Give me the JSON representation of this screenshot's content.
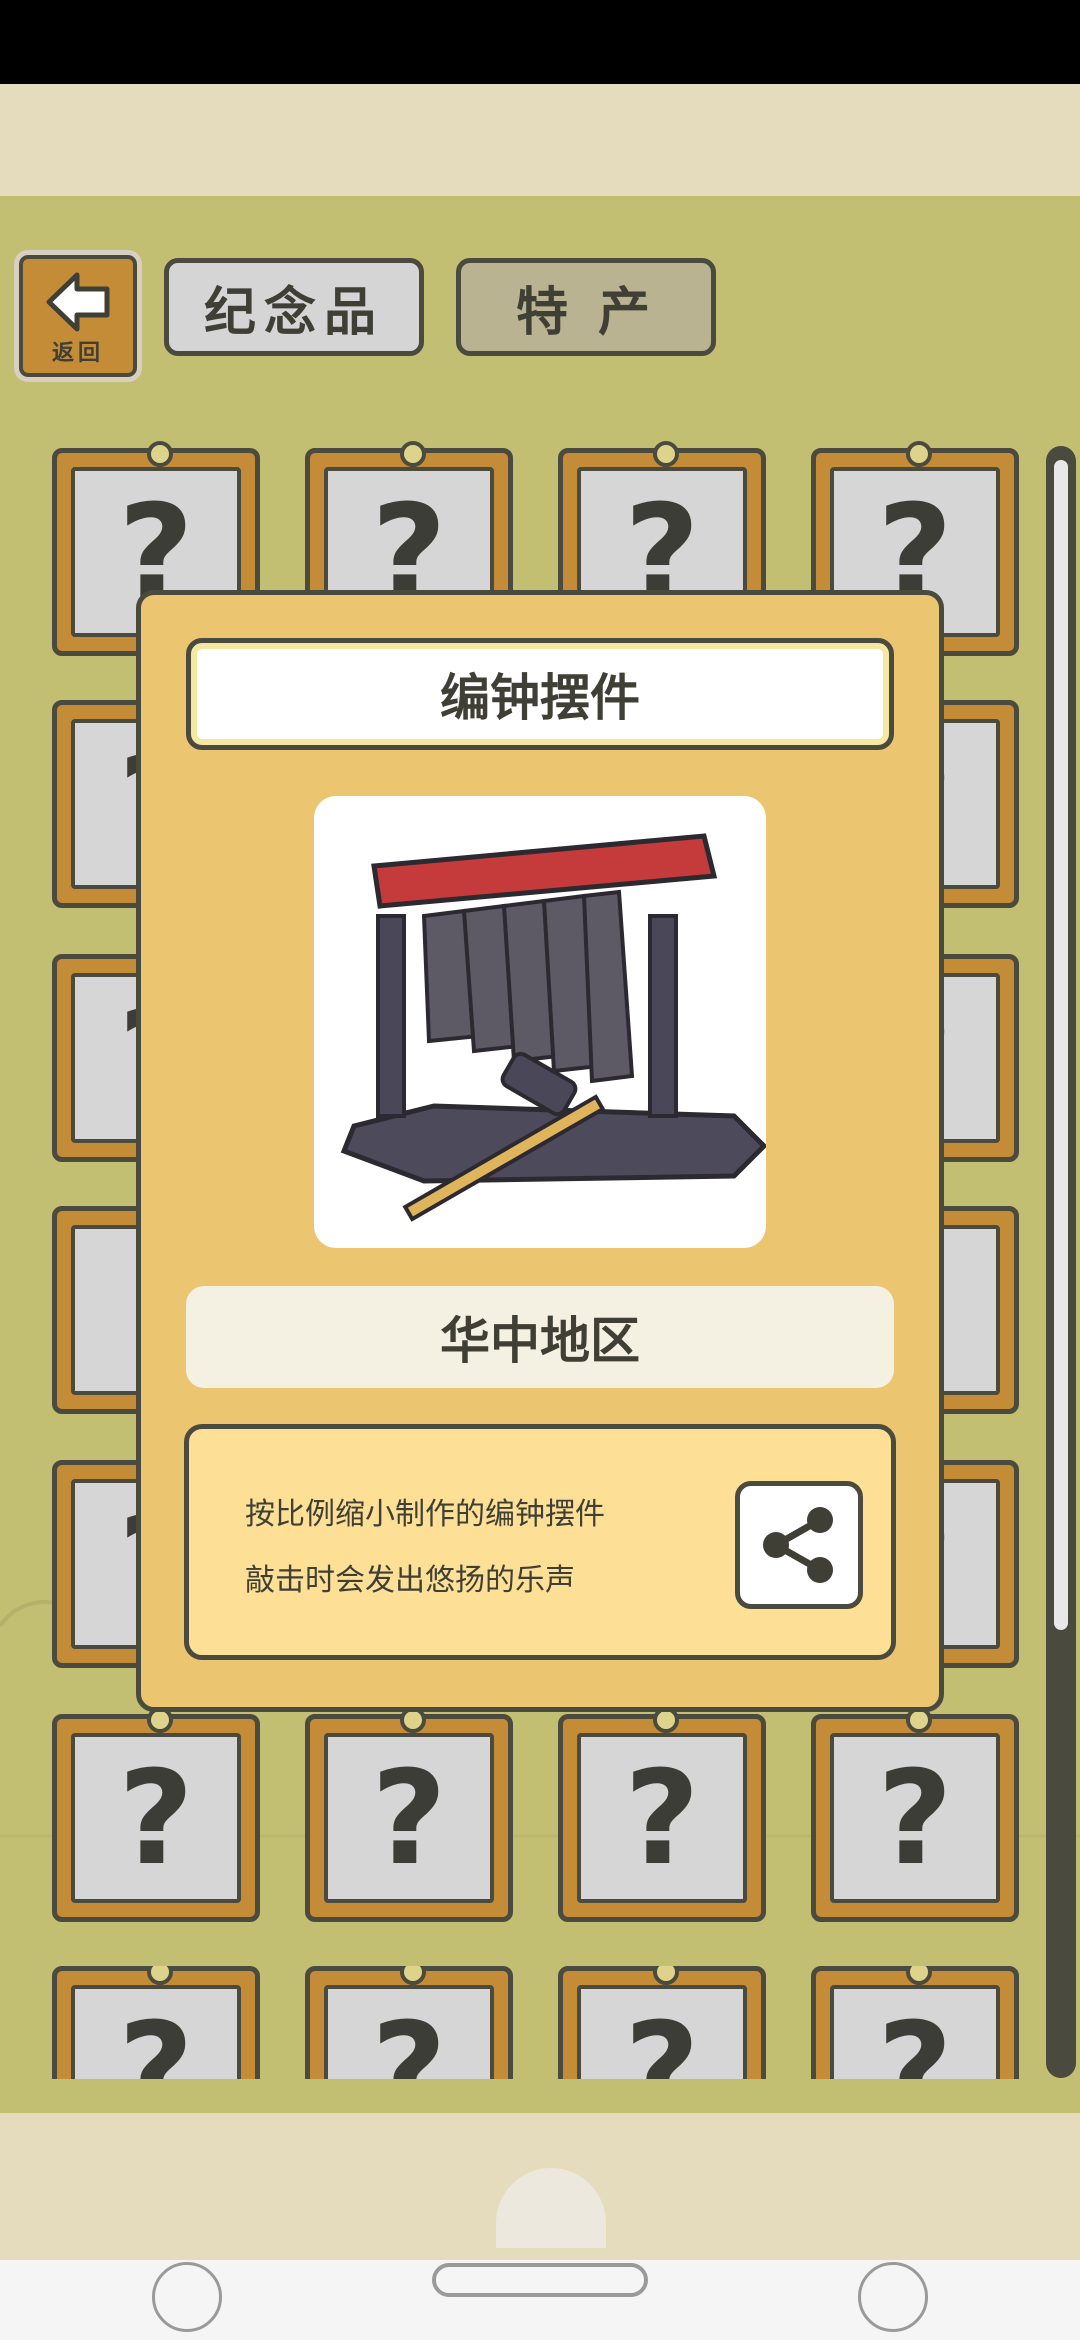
{
  "header": {
    "back_label": "返回",
    "tabs": [
      {
        "label": "纪念品"
      },
      {
        "label": "特产"
      }
    ]
  },
  "grid": {
    "placeholder_symbol": "?"
  },
  "dialog": {
    "item_title": "编钟摆件",
    "region": "华中地区",
    "description_lines": [
      "按比例缩小制作的编钟摆件",
      "敲击时会发出悠扬的乐声"
    ]
  },
  "colors": {
    "background_green": "#c2bf72",
    "card_wood": "#c48c36",
    "dialog_bg": "#ecc571",
    "desc_bg": "#fde096",
    "outline": "#4b4a3e"
  },
  "icons": {
    "back": "back-arrow-icon",
    "share": "share-icon",
    "nav_left": "recents-icon",
    "nav_right": "assistant-icon"
  }
}
